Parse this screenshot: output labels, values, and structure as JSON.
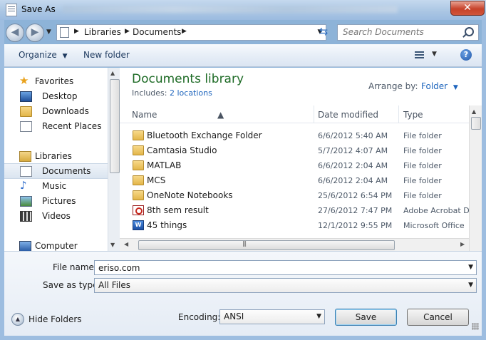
{
  "window": {
    "title": "Save As",
    "close_label": "✕"
  },
  "address": {
    "crumbs": [
      "Libraries",
      "Documents"
    ]
  },
  "search": {
    "placeholder": "Search Documents"
  },
  "toolbar": {
    "organize_label": "Organize",
    "new_folder_label": "New folder",
    "help_label": "?"
  },
  "sidebar": {
    "items": [
      {
        "label": "Favorites",
        "icon": "star-icon",
        "header": true
      },
      {
        "label": "Desktop",
        "icon": "desktop-icon"
      },
      {
        "label": "Downloads",
        "icon": "downloads-folder-icon"
      },
      {
        "label": "Recent Places",
        "icon": "recent-places-icon"
      },
      {
        "label": "Libraries",
        "icon": "libraries-icon",
        "header": true
      },
      {
        "label": "Documents",
        "icon": "documents-icon",
        "selected": true
      },
      {
        "label": "Music",
        "icon": "music-icon"
      },
      {
        "label": "Pictures",
        "icon": "pictures-icon"
      },
      {
        "label": "Videos",
        "icon": "videos-icon"
      },
      {
        "label": "Computer",
        "icon": "computer-icon",
        "header": true
      }
    ]
  },
  "library": {
    "title": "Documents library",
    "includes_label": "Includes:",
    "includes_link": "2 locations",
    "arrange_label": "Arrange by:",
    "arrange_value": "Folder"
  },
  "columns": {
    "name": "Name",
    "date": "Date modified",
    "type": "Type"
  },
  "files": [
    {
      "name": "Bluetooth Exchange Folder",
      "date": "6/6/2012 5:40 AM",
      "type": "File folder",
      "icon": "folder-icon"
    },
    {
      "name": "Camtasia Studio",
      "date": "5/7/2012 4:07 AM",
      "type": "File folder",
      "icon": "folder-icon"
    },
    {
      "name": "MATLAB",
      "date": "6/6/2012 2:04 AM",
      "type": "File folder",
      "icon": "folder-icon"
    },
    {
      "name": "MCS",
      "date": "6/6/2012 2:04 AM",
      "type": "File folder",
      "icon": "folder-icon"
    },
    {
      "name": "OneNote Notebooks",
      "date": "25/6/2012 6:54 PM",
      "type": "File folder",
      "icon": "folder-icon"
    },
    {
      "name": "8th sem result",
      "date": "27/6/2012 7:47 PM",
      "type": "Adobe Acrobat D",
      "icon": "pdf-icon"
    },
    {
      "name": "45 things",
      "date": "12/1/2012 9:55 PM",
      "type": "Microsoft Office",
      "icon": "word-icon"
    }
  ],
  "form": {
    "file_name_label": "File name:",
    "file_name_value": "eriso.com",
    "save_type_label": "Save as type:",
    "save_type_value": "All Files",
    "encoding_label": "Encoding:",
    "encoding_value": "ANSI",
    "hide_folders_label": "Hide Folders",
    "save_label": "Save",
    "cancel_label": "Cancel"
  },
  "colors": {
    "library_title": "#1e6b26",
    "link": "#1e65bd",
    "close_button": "#c7422a"
  }
}
